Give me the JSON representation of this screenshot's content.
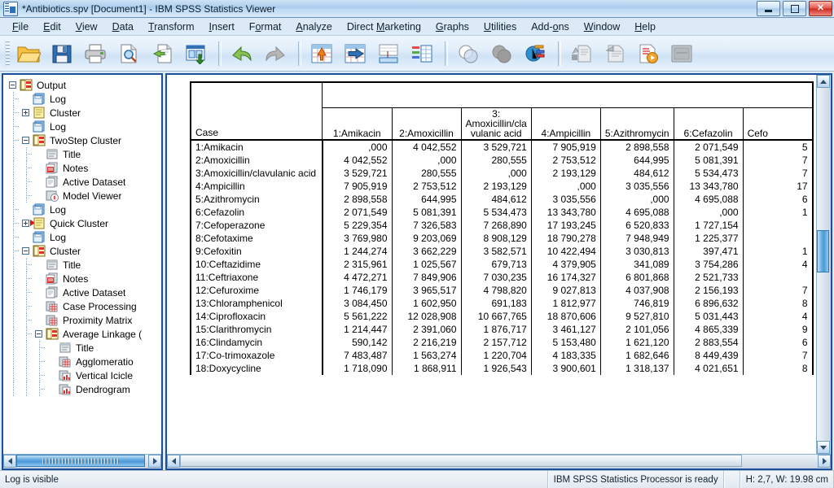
{
  "window": {
    "title": "*Antibiotics.spv [Document1] - IBM SPSS Statistics Viewer",
    "icon": "spss-viewer-icon",
    "minimize_label": "Minimize",
    "maximize_label": "Maximize",
    "close_label": "Close"
  },
  "menubar": {
    "items": [
      {
        "label": "File",
        "mnemonic": "F"
      },
      {
        "label": "Edit",
        "mnemonic": "E"
      },
      {
        "label": "View",
        "mnemonic": "V"
      },
      {
        "label": "Data",
        "mnemonic": "D"
      },
      {
        "label": "Transform",
        "mnemonic": "T"
      },
      {
        "label": "Insert",
        "mnemonic": "I"
      },
      {
        "label": "Format",
        "mnemonic": "o"
      },
      {
        "label": "Analyze",
        "mnemonic": "A"
      },
      {
        "label": "Direct Marketing",
        "mnemonic": "M"
      },
      {
        "label": "Graphs",
        "mnemonic": "G"
      },
      {
        "label": "Utilities",
        "mnemonic": "U"
      },
      {
        "label": "Add-ons",
        "mnemonic": "o"
      },
      {
        "label": "Window",
        "mnemonic": "W"
      },
      {
        "label": "Help",
        "mnemonic": "H"
      }
    ]
  },
  "toolbar": {
    "buttons": [
      {
        "name": "open-file-icon",
        "tooltip": "Open"
      },
      {
        "name": "save-icon",
        "tooltip": "Save"
      },
      {
        "name": "print-icon",
        "tooltip": "Print"
      },
      {
        "name": "print-preview-icon",
        "tooltip": "Print Preview"
      },
      {
        "name": "export-icon",
        "tooltip": "Export"
      },
      {
        "name": "dialog-recall-icon",
        "tooltip": "Recall recently used dialogs"
      },
      {
        "name": "undo-icon",
        "tooltip": "Undo"
      },
      {
        "name": "redo-icon",
        "tooltip": "Redo"
      },
      {
        "name": "goto-data-icon",
        "tooltip": "Go to data"
      },
      {
        "name": "goto-case-icon",
        "tooltip": "Go to case"
      },
      {
        "name": "variables-icon",
        "tooltip": "Variables"
      },
      {
        "name": "insert-table-icon",
        "tooltip": "Insert table"
      },
      {
        "name": "select-cases-icon",
        "tooltip": "Select cases"
      },
      {
        "name": "weight-cases-icon",
        "tooltip": "Weight cases"
      },
      {
        "name": "split-file-icon",
        "tooltip": "Split file"
      },
      {
        "name": "show-hide-icon",
        "tooltip": "Show/Hide"
      },
      {
        "name": "insert-text-icon",
        "tooltip": "Insert text"
      },
      {
        "name": "run-script-icon",
        "tooltip": "Run script"
      },
      {
        "name": "toggle-pane-icon",
        "tooltip": "Toggle pane"
      }
    ]
  },
  "outline": {
    "title": "Output outline",
    "nodes": [
      {
        "label": "Output",
        "depth": 0,
        "icon": "output-icon",
        "toggle": "minus",
        "marker": "none"
      },
      {
        "label": "Log",
        "depth": 1,
        "icon": "log-icon",
        "toggle": "none",
        "marker": "none"
      },
      {
        "label": "Cluster",
        "depth": 1,
        "icon": "note-icon",
        "toggle": "plus",
        "marker": "none"
      },
      {
        "label": "Log",
        "depth": 1,
        "icon": "log-icon",
        "toggle": "none",
        "marker": "none"
      },
      {
        "label": "TwoStep Cluster",
        "depth": 1,
        "icon": "output-icon",
        "toggle": "minus",
        "marker": "none"
      },
      {
        "label": "Title",
        "depth": 2,
        "icon": "title-icon",
        "toggle": "none",
        "marker": "none"
      },
      {
        "label": "Notes",
        "depth": 2,
        "icon": "notes-icon",
        "toggle": "none",
        "marker": "none"
      },
      {
        "label": "Active Dataset",
        "depth": 2,
        "icon": "dataset-icon",
        "toggle": "none",
        "marker": "none"
      },
      {
        "label": "Model Viewer",
        "depth": 2,
        "icon": "model-viewer-icon",
        "toggle": "none",
        "marker": "none"
      },
      {
        "label": "Log",
        "depth": 1,
        "icon": "log-icon",
        "toggle": "none",
        "marker": "none"
      },
      {
        "label": "Quick Cluster",
        "depth": 1,
        "icon": "note-icon",
        "toggle": "plus",
        "marker": "red-arrow"
      },
      {
        "label": "Log",
        "depth": 1,
        "icon": "log-icon",
        "toggle": "none",
        "marker": "none"
      },
      {
        "label": "Cluster",
        "depth": 1,
        "icon": "output-icon",
        "toggle": "minus",
        "marker": "none"
      },
      {
        "label": "Title",
        "depth": 2,
        "icon": "title-icon",
        "toggle": "none",
        "marker": "none"
      },
      {
        "label": "Notes",
        "depth": 2,
        "icon": "notes-icon",
        "toggle": "none",
        "marker": "none"
      },
      {
        "label": "Active Dataset",
        "depth": 2,
        "icon": "dataset-icon",
        "toggle": "none",
        "marker": "none"
      },
      {
        "label": "Case Processing",
        "depth": 2,
        "icon": "table-icon",
        "toggle": "none",
        "marker": "none"
      },
      {
        "label": "Proximity Matrix",
        "depth": 2,
        "icon": "table-icon",
        "toggle": "none",
        "marker": "none"
      },
      {
        "label": "Average Linkage (",
        "depth": 2,
        "icon": "output-icon",
        "toggle": "minus",
        "marker": "none"
      },
      {
        "label": "Title",
        "depth": 3,
        "icon": "title-icon",
        "toggle": "none",
        "marker": "none"
      },
      {
        "label": "Agglomeratio",
        "depth": 3,
        "icon": "table-icon",
        "toggle": "none",
        "marker": "none"
      },
      {
        "label": "Vertical Icicle",
        "depth": 3,
        "icon": "chart-icon",
        "toggle": "none",
        "marker": "none"
      },
      {
        "label": "Dendrogram",
        "depth": 3,
        "icon": "chart-icon",
        "toggle": "none",
        "marker": "none"
      }
    ]
  },
  "chart_data": {
    "type": "table",
    "title": "Proximity Matrix",
    "corner_header": "Case",
    "columns": [
      "1:Amikacin",
      "2:Amoxicillin",
      "3:\nAmoxicillin/cla\nvulanic acid",
      "4:Ampicillin",
      "5:Azithromycin",
      "6:Cefazolin",
      "Cefo"
    ],
    "row_labels": [
      "1:Amikacin",
      "2:Amoxicillin",
      "3:Amoxicillin/clavulanic acid",
      "4:Ampicillin",
      "5:Azithromycin",
      "6:Cefazolin",
      "7:Cefoperazone",
      "8:Cefotaxime",
      "9:Cefoxitin",
      "10:Ceftazidime",
      "11:Ceftriaxone",
      "12:Cefuroxime",
      "13:Chloramphenicol",
      "14:Ciprofloxacin",
      "15:Clarithromycin",
      "16:Clindamycin",
      "17:Co-trimoxazole",
      "18:Doxycycline"
    ],
    "rows": [
      [
        "1:Amikacin",
        ",000",
        "4 042,552",
        "3 529,721",
        "7 905,919",
        "2 898,558",
        "2 071,549",
        "5"
      ],
      [
        "2:Amoxicillin",
        "4 042,552",
        ",000",
        "280,555",
        "2 753,512",
        "644,995",
        "5 081,391",
        "7"
      ],
      [
        "3:Amoxicillin/clavulanic acid",
        "3 529,721",
        "280,555",
        ",000",
        "2 193,129",
        "484,612",
        "5 534,473",
        "7"
      ],
      [
        "4:Ampicillin",
        "7 905,919",
        "2 753,512",
        "2 193,129",
        ",000",
        "3 035,556",
        "13 343,780",
        "17"
      ],
      [
        "5:Azithromycin",
        "2 898,558",
        "644,995",
        "484,612",
        "3 035,556",
        ",000",
        "4 695,088",
        "6"
      ],
      [
        "6:Cefazolin",
        "2 071,549",
        "5 081,391",
        "5 534,473",
        "13 343,780",
        "4 695,088",
        ",000",
        "1"
      ],
      [
        "7:Cefoperazone",
        "5 229,354",
        "7 326,583",
        "7 268,890",
        "17 193,245",
        "6 520,833",
        "1 727,154",
        ""
      ],
      [
        "8:Cefotaxime",
        "3 769,980",
        "9 203,069",
        "8 908,129",
        "18 790,278",
        "7 948,949",
        "1 225,377",
        ""
      ],
      [
        "9:Cefoxitin",
        "1 244,274",
        "3 662,229",
        "3 582,571",
        "10 422,494",
        "3 030,813",
        "397,471",
        "1"
      ],
      [
        "10:Ceftazidime",
        "2 315,961",
        "1 025,567",
        "679,713",
        "4 379,905",
        "341,089",
        "3 754,286",
        "4"
      ],
      [
        "11:Ceftriaxone",
        "4 472,271",
        "7 849,906",
        "7 030,235",
        "16 174,327",
        "6 801,868",
        "2 521,733",
        ""
      ],
      [
        "12:Cefuroxime",
        "1 746,179",
        "3 965,517",
        "4 798,820",
        "9 027,813",
        "4 037,908",
        "2 156,193",
        "7"
      ],
      [
        "13:Chloramphenicol",
        "3 084,450",
        "1 602,950",
        "691,183",
        "1 812,977",
        "746,819",
        "6 896,632",
        "8"
      ],
      [
        "14:Ciprofloxacin",
        "5 561,222",
        "12 028,908",
        "10 667,765",
        "18 870,606",
        "9 527,810",
        "5 031,443",
        "4"
      ],
      [
        "15:Clarithromycin",
        "1 214,447",
        "2 391,060",
        "1 876,717",
        "3 461,127",
        "2 101,056",
        "4 865,339",
        "9"
      ],
      [
        "16:Clindamycin",
        "590,142",
        "2 216,219",
        "2 157,712",
        "5 153,480",
        "1 621,120",
        "2 883,554",
        "6"
      ],
      [
        "17:Co-trimoxazole",
        "7 483,487",
        "1 563,274",
        "1 220,704",
        "4 183,335",
        "1 682,646",
        "8 449,439",
        "7"
      ],
      [
        "18:Doxycycline",
        "1 718,090",
        "1 868,911",
        "1 926,543",
        "3 900,601",
        "1 318,137",
        "4 021,651",
        "8"
      ]
    ]
  },
  "statusbar": {
    "left": "Log is visible",
    "processor": "IBM SPSS Statistics Processor is ready",
    "spacer": "",
    "dimensions": "H: 2,7, W: 19.98 cm"
  }
}
